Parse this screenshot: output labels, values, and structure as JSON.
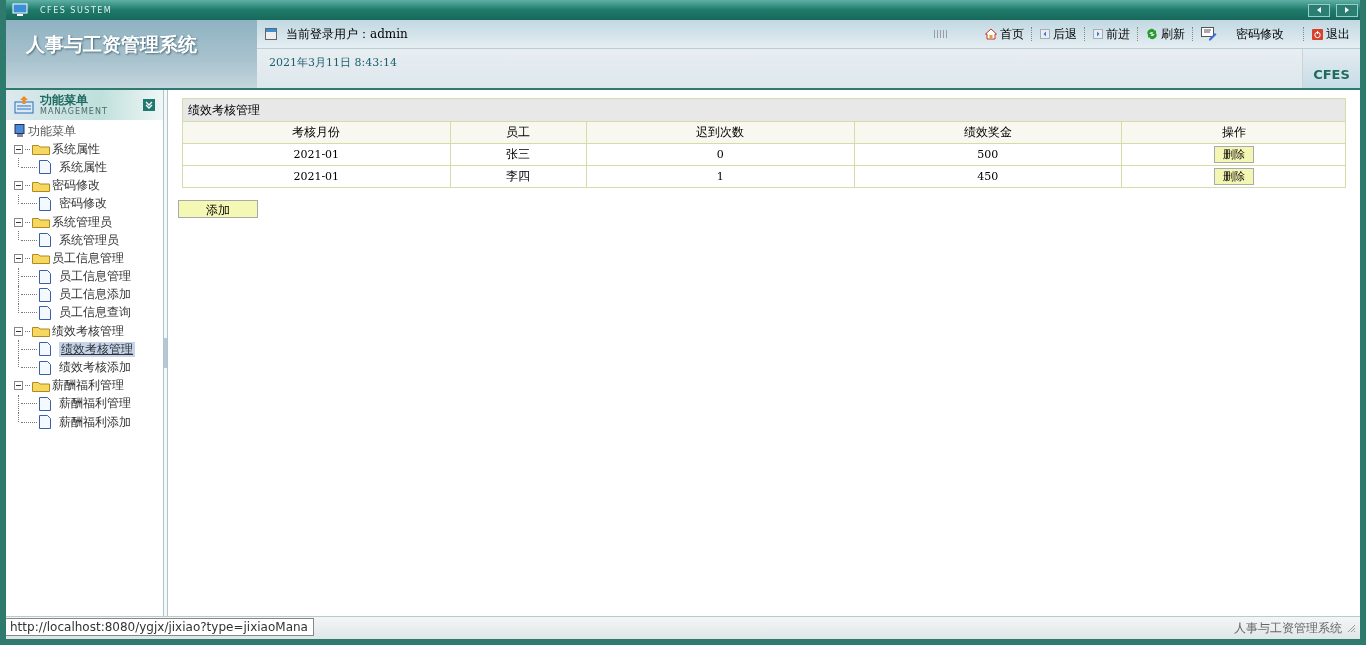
{
  "window": {
    "title": "CFES SUSTEM"
  },
  "header": {
    "app_title": "人事与工资管理系统",
    "user_label": "当前登录用户：",
    "user_name": "admin",
    "datetime": "2021年3月11日 8:43:14",
    "brand": "CFES"
  },
  "toolbar": [
    {
      "kind": "home",
      "label": "首页"
    },
    {
      "kind": "back",
      "label": "后退"
    },
    {
      "kind": "forward",
      "label": "前进"
    },
    {
      "kind": "refresh",
      "label": "刷新"
    },
    {
      "kind": "edit",
      "label": "密码修改"
    },
    {
      "kind": "exit",
      "label": "退出"
    }
  ],
  "sidebar": {
    "title": "功能菜单",
    "subtitle": "MANAGEMENT",
    "root": "功能菜单",
    "tree": [
      {
        "label": "系统属性",
        "expanded": true,
        "children": [
          {
            "label": "系统属性",
            "selected": false
          }
        ]
      },
      {
        "label": "密码修改",
        "expanded": true,
        "children": [
          {
            "label": "密码修改",
            "selected": false
          }
        ]
      },
      {
        "label": "系统管理员",
        "expanded": true,
        "children": [
          {
            "label": "系统管理员",
            "selected": false
          }
        ]
      },
      {
        "label": "员工信息管理",
        "expanded": true,
        "children": [
          {
            "label": "员工信息管理",
            "selected": false
          },
          {
            "label": "员工信息添加",
            "selected": false
          },
          {
            "label": "员工信息查询",
            "selected": false
          }
        ]
      },
      {
        "label": "绩效考核管理",
        "expanded": true,
        "children": [
          {
            "label": "绩效考核管理",
            "selected": true
          },
          {
            "label": "绩效考核添加",
            "selected": false
          }
        ]
      },
      {
        "label": "薪酬福利管理",
        "expanded": true,
        "children": [
          {
            "label": "薪酬福利管理",
            "selected": false
          },
          {
            "label": "薪酬福利添加",
            "selected": false
          }
        ]
      }
    ]
  },
  "table": {
    "title": "绩效考核管理",
    "columns": [
      "考核月份",
      "员工",
      "迟到次数",
      "绩效奖金",
      "操作"
    ],
    "rows": [
      {
        "cells": [
          "2021-01",
          "张三",
          "0",
          "500"
        ],
        "action": "删除"
      },
      {
        "cells": [
          "2021-01",
          "李四",
          "1",
          "450"
        ],
        "action": "删除"
      }
    ]
  },
  "add_button": "添加",
  "status_bar": {
    "text": "人事与工资管理系统",
    "link_tooltip": "http://localhost:8080/ygjx/jixiao?type=jixiaoMana"
  }
}
